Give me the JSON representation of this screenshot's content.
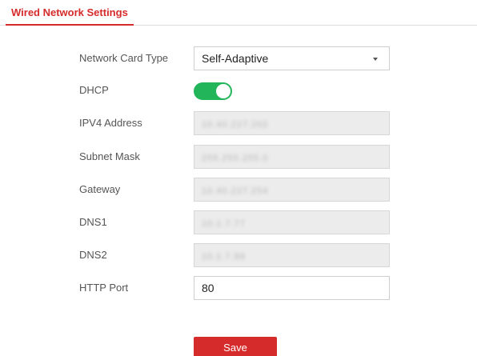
{
  "colors": {
    "accent": "#d62b2b",
    "toggle_on": "#22b559",
    "save_button": "#d62b2b"
  },
  "tab": {
    "label": "Wired Network Settings"
  },
  "form": {
    "network_card_type": {
      "label": "Network Card Type",
      "value": "Self-Adaptive",
      "icon": "caret-down-icon"
    },
    "dhcp": {
      "label": "DHCP",
      "state": "on"
    },
    "ipv4_address": {
      "label": "IPV4 Address",
      "value": "10.40.227.202"
    },
    "subnet_mask": {
      "label": "Subnet Mask",
      "value": "255.255.255.0"
    },
    "gateway": {
      "label": "Gateway",
      "value": "10.40.227.254"
    },
    "dns1": {
      "label": "DNS1",
      "value": "10.1.7.77"
    },
    "dns2": {
      "label": "DNS2",
      "value": "10.1.7.88"
    },
    "http_port": {
      "label": "HTTP Port",
      "value": "80"
    }
  },
  "actions": {
    "save_label": "Save"
  }
}
